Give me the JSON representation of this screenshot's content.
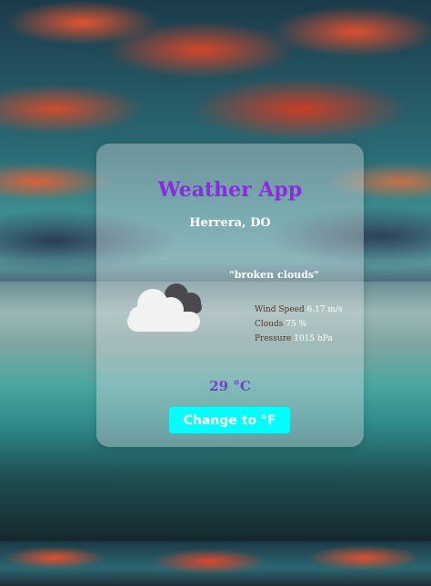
{
  "app": {
    "title": "Weather App",
    "location": "Herrera, DO",
    "description": "\"broken clouds\"",
    "details": {
      "wind_label": "Wind Speed",
      "wind_value": "6.17 m/s",
      "clouds_label": "Clouds",
      "clouds_value": "75 %",
      "pressure_label": "Pressure",
      "pressure_value": "1015 hPa"
    },
    "temperature": "29 °C",
    "toggle_button_label": "Change to °F",
    "weather_icon": "broken-clouds-icon"
  },
  "colors": {
    "title": "#8a2be2",
    "temperature": "#7a3fd0",
    "button_bg": "#00ffff",
    "button_text": "#ffffff"
  }
}
